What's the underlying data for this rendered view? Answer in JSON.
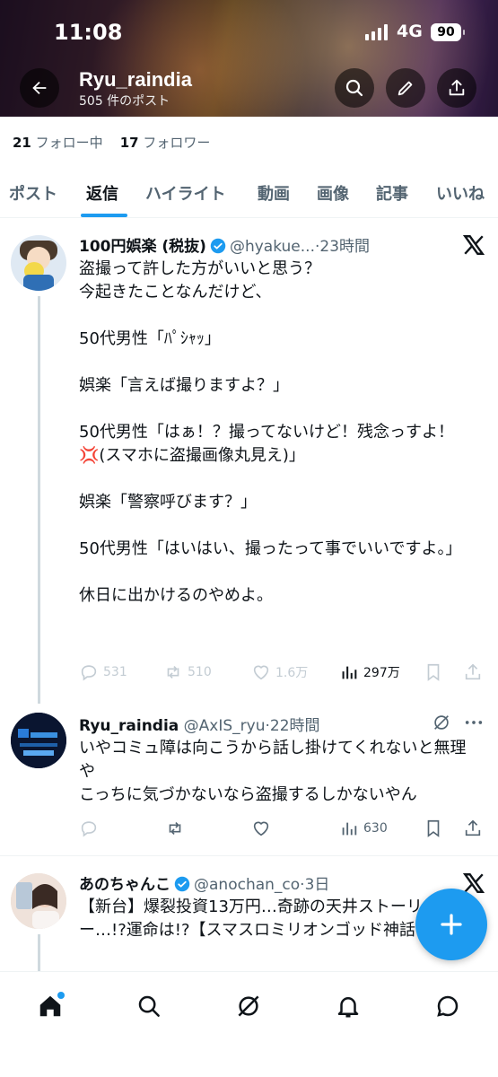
{
  "status_bar": {
    "time": "11:08",
    "network": "4G",
    "battery": "90"
  },
  "header": {
    "title": "Ryu_raindia",
    "post_count": "505 件のポスト"
  },
  "follow": {
    "following_count": "21",
    "following_label": "フォロー中",
    "followers_count": "17",
    "followers_label": "フォロワー"
  },
  "tabs": [
    "ポスト",
    "返信",
    "ハイライト",
    "動画",
    "画像",
    "記事",
    "いいね"
  ],
  "active_tab": "返信",
  "tweets": [
    {
      "name": "100円娯楽 (税抜)",
      "handle": "@hyakue...",
      "time": "23時間",
      "body": "盗撮って許した方がいいと思う？\n今起きたことなんだけど、\n\n50代男性「ﾊﾟｼｬｯ」\n\n娯楽「言えば撮りますよ？」\n\n50代男性「はぁ！？撮ってないけど！残念っすよ！💢(スマホに盗撮画像丸見え)」\n\n娯楽「警察呼びます？」\n\n50代男性「はいはい、撮ったって事でいいですよ。」\n\n休日に出かけるのやめよ。",
      "replies": "531",
      "reposts": "510",
      "likes": "1.6万",
      "views": "297万"
    },
    {
      "name": "Ryu_raindia",
      "handle": "@AxIS_ryu",
      "time": "22時間",
      "body": "いやコミュ障は向こうから話し掛けてくれないと無理や\nこっちに気づかないなら盗撮するしかないやん",
      "views": "630"
    },
    {
      "name": "あのちゃんこ",
      "handle": "@anochan_co",
      "time": "3日",
      "body": "【新台】爆裂投資13万円…奇跡の天井ストーリー…!?運命は!?【スマスロミリオンゴッド神話 跡】"
    }
  ],
  "colors": {
    "accent": "#1d9bf0",
    "text": "#0f1419",
    "muted": "#536471"
  },
  "icons": [
    "back-arrow-icon",
    "search-icon",
    "edit-icon",
    "share-icon",
    "x-logo-icon",
    "verified-badge-icon",
    "grok-icon",
    "more-icon",
    "reply-icon",
    "repost-icon",
    "like-icon",
    "views-icon",
    "bookmark-icon",
    "home-icon",
    "notifications-icon",
    "messages-icon",
    "plus-icon"
  ]
}
